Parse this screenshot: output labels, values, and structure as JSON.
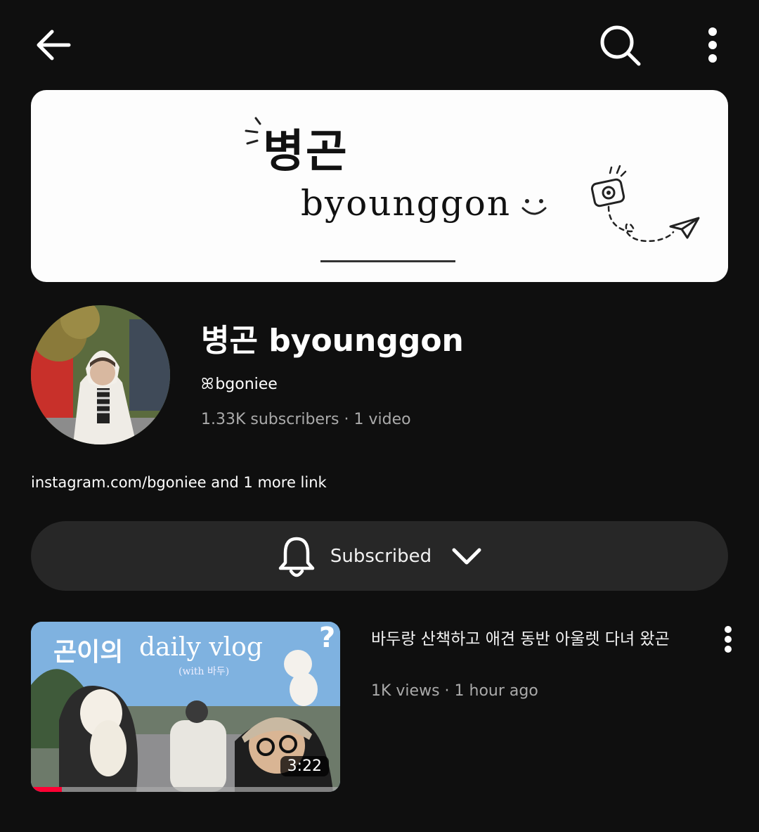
{
  "banner": {
    "korean_text": "병곤",
    "english_text": "byounggon"
  },
  "channel": {
    "name": "병곤  byounggon",
    "handle_glyph": "ꕤ",
    "handle": "bgoniee",
    "stats": "1.33K  subscribers · 1  video"
  },
  "links": {
    "url": "instagram.com/bgoniee",
    "more": " and  1  more  link"
  },
  "subscribe": {
    "label": "Subscribed"
  },
  "video": {
    "thumb_title_ko": "곤이의",
    "thumb_title_en": "daily vlog",
    "thumb_subtitle": "(with 바두)",
    "thumb_mark": "?",
    "duration": "3:22",
    "progress": 0.1,
    "title": "바두랑 산책하고 애견 동반 아울렛 다녀 왔곤",
    "meta": "1K  views  ·  1  hour  ago"
  },
  "colors": {
    "background": "#0f0f0f",
    "surface": "#272727",
    "progress": "#ff0033",
    "secondary_text": "#aaaaaa"
  },
  "icons": [
    "back-arrow-icon",
    "search-icon",
    "more-vert-icon",
    "bell-icon",
    "chevron-down-icon"
  ]
}
